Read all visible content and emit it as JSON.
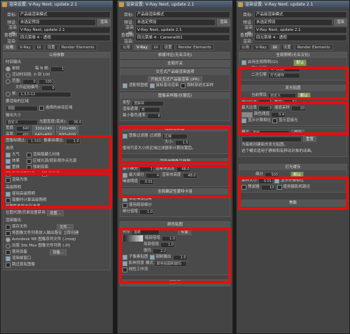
{
  "window": {
    "title": "渲染设置: V-Ray Next, update 2.1"
  },
  "header": {
    "target_label": "目标:",
    "target_value": "产品级渲染模式",
    "preset_label": "预设:",
    "preset_value": "未选定预设",
    "renderer_label": "渲染器:",
    "renderer_value": "V-Ray Next, update 2.1",
    "save_label": "保存文件",
    "render_button": "渲染",
    "view_label": "查看到渲染:",
    "view_value_1": "四元菜单 4 - 透视",
    "view_value_2": "四元菜单 4 - Camera001"
  },
  "tabs": [
    "公用",
    "V-Ray",
    "GI",
    "设置",
    "Render Elements"
  ],
  "panel1": {
    "rollout_title": "公用参数",
    "time_output": "时间输出",
    "single": "单帧",
    "every_n": "每 N 帧:",
    "every_n_val": "1",
    "active_segment": "活动时间段:",
    "active_segment_val": "0 到 100",
    "range": "范围:",
    "range_from": "0",
    "range_to": "100",
    "file_start": "文件起始编号:",
    "file_start_val": "0",
    "frames": "帧:",
    "frames_val": "1,3,5-12",
    "area_title": "要渲染的区域",
    "area_value": "视图",
    "auto_region": "选择的自动区域",
    "output_size": "输出大小",
    "custom": "自定义",
    "aperture": "光圈宽度(毫米):",
    "aperture_val": "36.0",
    "width": "宽度:",
    "width_val": "640",
    "height": "高度:",
    "height_val": "480",
    "res": [
      "320x240",
      "720x486",
      "640x480",
      "800x600"
    ],
    "aspect": "图像纵横比:",
    "aspect_val": "1.333",
    "pixel_aspect": "像素纵横比:",
    "pixel_aspect_val": "1.0",
    "options": "选项",
    "opts": [
      "大气",
      "渲染隐藏几何体",
      "效果",
      "区域光源/阴影视作点光源",
      "置换",
      "强制双面",
      "视频颜色检查",
      "超级黑",
      "渲染为场"
    ],
    "adv_lighting": "高级照明",
    "use_adv": "使用高级照明",
    "compute_adv": "需要时计算高级照明",
    "bitmap_perf": "位图性能和内存选项",
    "bitmap_proxy": "位图代理/页面设置禁用",
    "setup_btn": "设置...",
    "render_output": "渲染输出",
    "save_file": "保存文件",
    "files_btn": "文件...",
    "split_channels": "将图像文件列表放入输出路径",
    "create_now": "立即创建",
    "autodesk": "Autodesk ME 图像序列文件 (.imsq)",
    "legacy": "旧版 3ds Max 图像文件列表 (.ifl)",
    "use_device": "使用设备",
    "devices_btn": "设备...",
    "render_frame": "渲染帧窗口",
    "skip_existing": "跳过现有图像"
  },
  "panel2": {
    "r1": "帧缓冲区(无名汉化)",
    "r2": "全局开关",
    "r3": "交互式产品级渲染选项",
    "r3_btn": "开始交互式产品级渲染 (IPR)",
    "r3_opt1": "适配视图框",
    "r3_opt2": "鼠标驱动渲染",
    "r3_opt3": "强制渐进式采样",
    "r4": "图像采样器(抗锯齿)",
    "type_label": "类型",
    "type_val": "渲染块",
    "render_mask": "渲染遮罩",
    "render_mask_val": "无",
    "min_shading": "最小着色速率",
    "min_shading_val": "6",
    "r5": "图像过滤器",
    "filter_on": "图像过滤器",
    "filter_label": "过滤器",
    "filter_val": "区域",
    "size_label": "大小:",
    "size_val": "1.5",
    "filter_desc": "使用可变大小的区域过滤器来计算抗锯齿。",
    "r6": "渲染块图像采样器",
    "min_sub": "最小细分",
    "min_sub_val": "1",
    "block_w": "渲染块宽度",
    "block_w_val": "48.0",
    "max_sub": "最大细分",
    "max_sub_val": "4",
    "block_h": "渲染块高度",
    "block_h_val": "48.0",
    "noise": "噪波阈值",
    "noise_val": "0.01",
    "r7": "全局确定性蒙特卡洛",
    "lock_noise": "锁定噪波图案",
    "use_local": "使用局部细分",
    "sub_mult": "细分倍增",
    "sub_mult_val": "1.0",
    "r8": "颜色贴图",
    "cm_type": "类型",
    "cm_type_val": "指数",
    "expert": "专家",
    "default_btn": "默认",
    "dark_mult": "暗部倍增",
    "dark_val": "1.0",
    "bright_mult": "亮部倍增",
    "bright_val": "1.0",
    "gamma": "伽玛",
    "gamma_val": "2.2",
    "sub_pixel": "子像素贴图",
    "clamp": "钳制输出",
    "clamp_val": "1.0",
    "affect_bg": "影响背景",
    "mode": "模式",
    "mode_val": "颜色贴图和伽玛",
    "linear": "线性工作流",
    "r9": "摄影机"
  },
  "panel3": {
    "r1": "全局照明(无名汉化)",
    "enable_gi": "启用全局照明(GI)",
    "default_btn": "默认",
    "primary": "首次引擎",
    "primary_val": "发光贴图",
    "secondary": "二次引擎",
    "secondary_val": "灯光缓存",
    "r2": "发光贴图",
    "preset": "当前预设",
    "preset_val": "自定义",
    "min_rate": "最小比率",
    "min_rate_val": "-3",
    "subdiv": "细分",
    "subdiv_val": "50",
    "max_rate": "最大比率",
    "max_rate_val": "-3",
    "interp": "插值采样",
    "interp_val": "20",
    "color_th": "颜色阈值",
    "color_th_val": "0.4",
    "show_calc": "显示计算相位",
    "show_direct": "显示直接光",
    "mode": "模式",
    "mode_val": "单帧",
    "save_btn": "保存",
    "reset_btn": "重置",
    "desc1": "为每帧创建新的发光贴图。",
    "desc2": "这个模式适用于静帧和有移动对象的动画。",
    "r3": "灯光缓存",
    "lc_subdiv": "细分",
    "lc_subdiv_val": "500",
    "sample_size": "采样大小",
    "sample_size_val": "0.01",
    "lc_default": "默认",
    "show_calc2": "显示计算相位",
    "pre_filter": "预滤器",
    "pre_filter_val": "10",
    "use_camera": "使用摄影机路径",
    "r4": "焦散"
  }
}
